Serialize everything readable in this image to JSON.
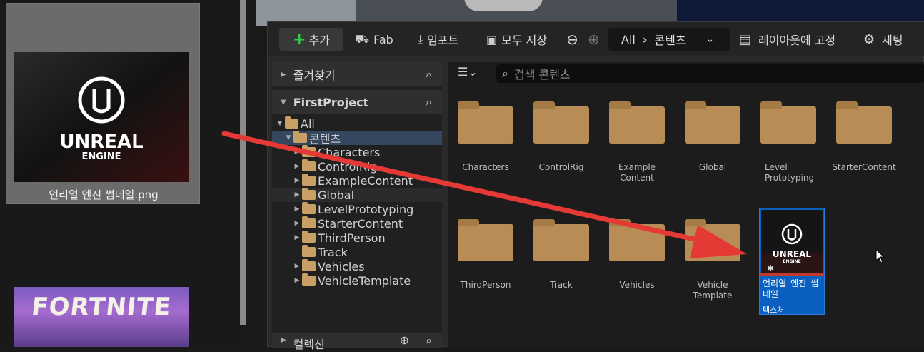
{
  "desktop": {
    "file_name": "언리얼 엔진 썸네일.png",
    "thumb_logo": "UNREAL",
    "thumb_sub": "ENGINE",
    "second_thumb_text": "FORTNITE"
  },
  "toolbar": {
    "add": "추가",
    "fab": "Fab",
    "import": "임포트",
    "save_all": "모두 저장",
    "crumb_root": "All",
    "crumb_child": "콘텐츠",
    "pin_layout": "레이아웃에 고정",
    "settings": "세팅"
  },
  "sidebar": {
    "favorites": "즐겨찾기",
    "project": "FirstProject",
    "collections": "컬렉션",
    "tree": [
      {
        "label": "All"
      },
      {
        "label": "콘텐츠"
      },
      {
        "label": "Characters"
      },
      {
        "label": "ControlRig"
      },
      {
        "label": "ExampleContent"
      },
      {
        "label": "Global"
      },
      {
        "label": "LevelPrototyping"
      },
      {
        "label": "StarterContent"
      },
      {
        "label": "ThirdPerson"
      },
      {
        "label": "Track"
      },
      {
        "label": "Vehicles"
      },
      {
        "label": "VehicleTemplate"
      }
    ]
  },
  "content": {
    "search_placeholder": "검색 콘텐츠",
    "folders": [
      {
        "label": "Characters"
      },
      {
        "label": "ControlRig"
      },
      {
        "label": "Example Content"
      },
      {
        "label": "Global"
      },
      {
        "label": "Level Prototyping"
      },
      {
        "label": "StarterContent"
      },
      {
        "label": "ThirdPerson"
      },
      {
        "label": "Track"
      },
      {
        "label": "Vehicles"
      },
      {
        "label": "Vehicle Template"
      }
    ],
    "asset": {
      "name": "언리얼_엔진_썸네일",
      "type": "텍스처",
      "logo": "UNREAL",
      "logo_sub": "ENGINE"
    }
  },
  "colors": {
    "accent": "#0b5fbf",
    "folder": "#b88d55",
    "arrow": "#e53935",
    "add_plus": "#35c94a"
  }
}
